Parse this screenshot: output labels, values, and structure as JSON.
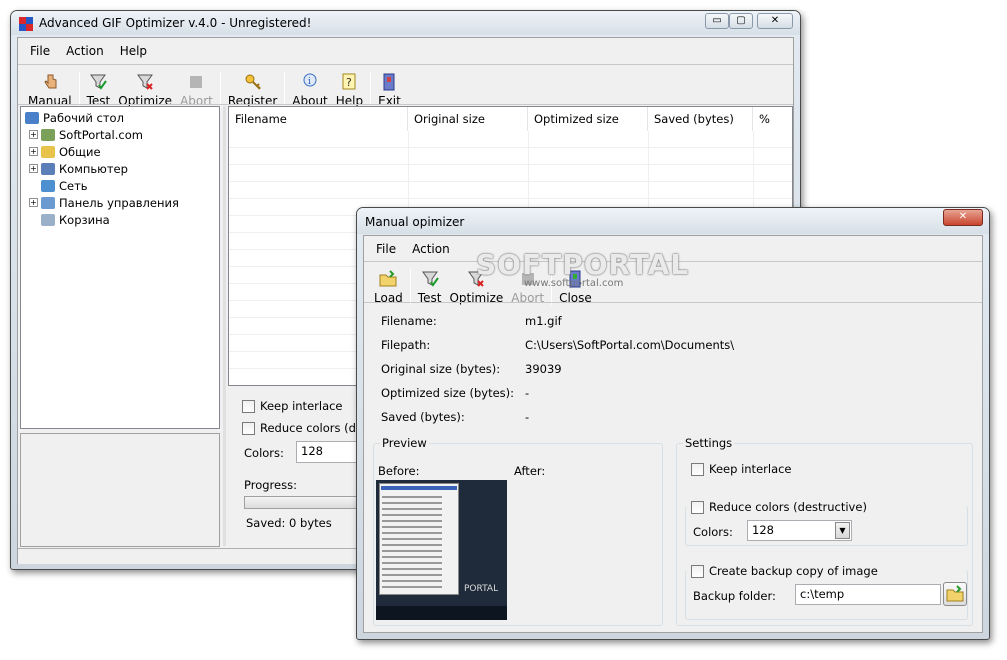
{
  "main": {
    "title": "Advanced GIF Optimizer v.4.0 - Unregistered!",
    "window_buttons": {
      "minimize": "▭",
      "maximize": "▢",
      "close": "✕"
    },
    "menu": [
      "File",
      "Action",
      "Help"
    ],
    "toolbar": {
      "manual": "Manual",
      "test": "Test",
      "optimize": "Optimize",
      "abort": "Abort",
      "register": "Register",
      "about": "About",
      "help": "Help",
      "exit": "Exit"
    },
    "tree": [
      {
        "label": "Рабочий стол",
        "icon": "desktop-icon",
        "expandable": false
      },
      {
        "label": "SoftPortal.com",
        "icon": "user-folder-icon",
        "expandable": true
      },
      {
        "label": "Общие",
        "icon": "folder-icon",
        "expandable": true
      },
      {
        "label": "Компьютер",
        "icon": "computer-icon",
        "expandable": true
      },
      {
        "label": "Сеть",
        "icon": "network-icon",
        "expandable": false
      },
      {
        "label": "Панель управления",
        "icon": "control-panel-icon",
        "expandable": true
      },
      {
        "label": "Корзина",
        "icon": "recycle-bin-icon",
        "expandable": false
      }
    ],
    "expand_glyph": "+",
    "columns": [
      "Filename",
      "Original size (bytes)",
      "Optimized size (bytes)",
      "Saved (bytes)",
      "%"
    ],
    "keep_interlace": "Keep interlace",
    "reduce_colors": "Reduce colors (destructive)",
    "colors_label": "Colors:",
    "colors_value": "128",
    "progress_label": "Progress:",
    "progress_fraction": 0,
    "saved": "Saved: 0 bytes"
  },
  "dialog": {
    "title": "Manual opimizer",
    "close_glyph": "✕",
    "menu": [
      "File",
      "Action"
    ],
    "toolbar": {
      "load": "Load",
      "test": "Test",
      "optimize": "Optimize",
      "abort": "Abort",
      "close": "Close"
    },
    "fields": [
      {
        "label": "Filename:",
        "value": "m1.gif"
      },
      {
        "label": "Filepath:",
        "value": "C:\\Users\\SoftPortal.com\\Documents\\"
      },
      {
        "label": "Original size (bytes):",
        "value": "39039"
      },
      {
        "label": "Optimized size (bytes):",
        "value": "-"
      },
      {
        "label": "Saved (bytes):",
        "value": "-"
      }
    ],
    "preview": {
      "title": "Preview",
      "before": "Before:",
      "after": "After:",
      "thumb_text": "PORTAL"
    },
    "settings": {
      "title": "Settings",
      "keep_interlace": "Keep interlace",
      "reduce_colors": "Reduce colors (destructive)",
      "colors_label": "Colors:",
      "colors_value": "128",
      "backup": "Create backup copy of image",
      "backup_folder_label": "Backup folder:",
      "backup_folder_value": "c:\\temp"
    },
    "watermark": {
      "brand": "SOFTPORTAL",
      "url": "www.softportal.com"
    }
  }
}
